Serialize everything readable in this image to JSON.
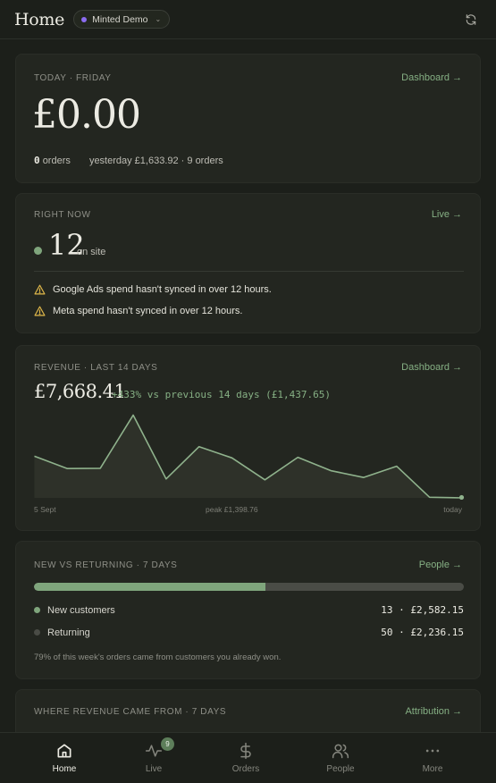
{
  "header": {
    "brand": "Home",
    "workspace": "Minted Demo",
    "workspace_dot_color": "#8b6cf0"
  },
  "today": {
    "label": "TODAY · FRIDAY",
    "link": "Dashboard",
    "amount": "£0.00",
    "orders_count": "0",
    "orders_suffix": "orders",
    "yesterday": "yesterday £1,633.92 · 9 orders"
  },
  "right_now": {
    "label": "RIGHT NOW",
    "link": "Live",
    "count": "12",
    "suffix": "on site",
    "warnings": [
      "Google Ads spend hasn't synced in over 12 hours.",
      "Meta spend hasn't synced in over 12 hours."
    ],
    "warning_color": "#e0b84a"
  },
  "revenue": {
    "label": "REVENUE · LAST 14 DAYS",
    "link": "Dashboard",
    "total": "£7,668.41",
    "change": "+433% vs previous 14 days (£1,437.65)",
    "start_label": "5 Sept",
    "peak_label": "peak £1,398.76",
    "end_label": "today"
  },
  "chart_data": {
    "type": "area",
    "x": [
      "5 Sept",
      "",
      "",
      "",
      "",
      "",
      "",
      "",
      "",
      "",
      "",
      "",
      "",
      "today"
    ],
    "values": [
      705,
      495,
      500,
      1398.76,
      320,
      865,
      675,
      305,
      685,
      460,
      345,
      535,
      10,
      0
    ],
    "ylim": [
      0,
      1450
    ],
    "color": "#8fb28c",
    "fill": "#2e3129"
  },
  "new_vs_returning": {
    "label": "NEW VS RETURNING · 7 DAYS",
    "link": "People",
    "new_fraction": 0.538,
    "rows": [
      {
        "label": "New customers",
        "value": "13 · £2,582.15",
        "color": "#7fa57c"
      },
      {
        "label": "Returning",
        "value": "50 · £2,236.15",
        "color": "#4a4c46"
      }
    ],
    "note": "79% of this week's orders came from customers you already won."
  },
  "attribution": {
    "label": "WHERE REVENUE CAME FROM · 7 DAYS",
    "link": "Attribution"
  },
  "nav": {
    "items": [
      {
        "label": "Home",
        "icon": "home-icon",
        "active": true
      },
      {
        "label": "Live",
        "icon": "pulse-icon",
        "badge": "9"
      },
      {
        "label": "Orders",
        "icon": "dollar-icon"
      },
      {
        "label": "People",
        "icon": "people-icon"
      },
      {
        "label": "More",
        "icon": "more-icon"
      }
    ]
  }
}
